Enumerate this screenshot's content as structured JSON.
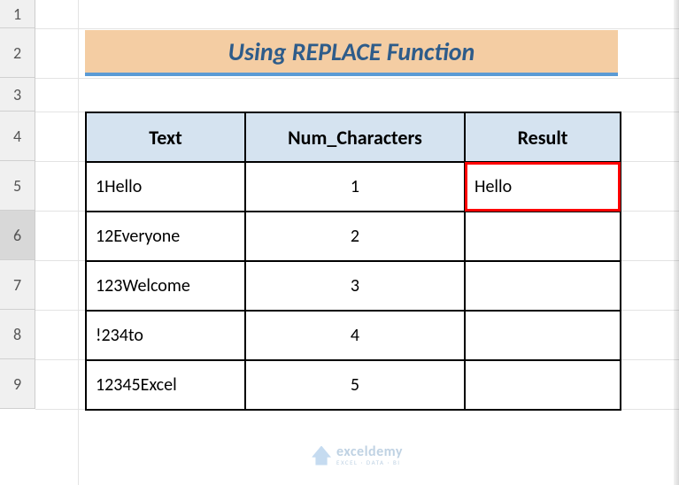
{
  "rowLabels": [
    "1",
    "2",
    "3",
    "4",
    "5",
    "6",
    "7",
    "8",
    "9"
  ],
  "activeRow": 6,
  "title": "Using REPLACE Function",
  "headers": {
    "text": "Text",
    "num": "Num_Characters",
    "result": "Result"
  },
  "rows": [
    {
      "text": "1Hello",
      "num": "1",
      "result": "Hello",
      "highlight": true
    },
    {
      "text": "12Everyone",
      "num": "2",
      "result": ""
    },
    {
      "text": "123Welcome",
      "num": "3",
      "result": ""
    },
    {
      "text": "!234to",
      "num": "4",
      "result": ""
    },
    {
      "text": "12345Excel",
      "num": "5",
      "result": ""
    }
  ],
  "watermark": {
    "main": "exceldemy",
    "sub": "EXCEL · DATA · BI"
  }
}
